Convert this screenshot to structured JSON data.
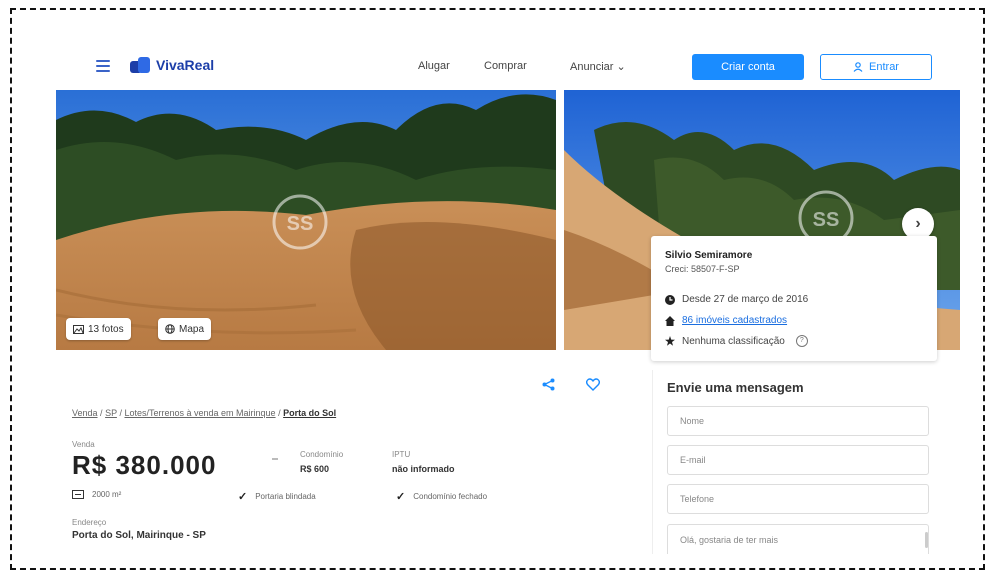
{
  "header": {
    "logo_text": "VivaReal",
    "nav": [
      "Alugar",
      "Comprar",
      "Anunciar"
    ],
    "primary_button": "Criar conta",
    "login_button": "Entrar"
  },
  "gallery": {
    "photos_label": "13 fotos",
    "map_label": "Mapa",
    "watermark": "SS"
  },
  "advertiser": {
    "name": "Silvio Semiramore",
    "creci": "Creci: 58507-F-SP",
    "since": "Desde 27 de março de 2016",
    "listings": "86 imóveis cadastrados",
    "rating": "Nenhuma classificação"
  },
  "breadcrumb": {
    "items": [
      "Venda",
      "SP",
      "Lotes/Terrenos à venda em Mairinque"
    ],
    "current": "Porta do Sol",
    "separator": "/"
  },
  "listing": {
    "price_label": "Venda",
    "price": "R$ 380.000",
    "condo_label": "Condomínio",
    "condo_value": "R$ 600",
    "iptu_label": "IPTU",
    "iptu_value": "não informado",
    "area": "2000 m²",
    "features": [
      "Portaria blindada",
      "Condomínio fechado"
    ],
    "address_label": "Endereço",
    "address": "Porta do Sol, Mairinque - SP"
  },
  "contact_form": {
    "title": "Envie uma mensagem",
    "name_placeholder": "Nome",
    "email_placeholder": "E-mail",
    "phone_placeholder": "Telefone",
    "message": "Olá, gostaria de ter mais"
  },
  "colors": {
    "accent": "#1a8cff",
    "brand": "#1c3ea8"
  }
}
